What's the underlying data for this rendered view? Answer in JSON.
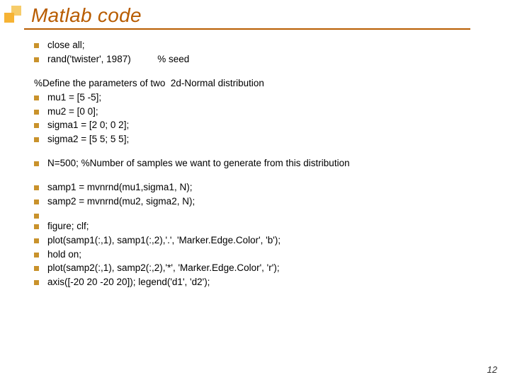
{
  "slide": {
    "title": "Matlab code",
    "page_number": "12",
    "lines": [
      {
        "bullet": true,
        "text": "close all;"
      },
      {
        "bullet": true,
        "text": "rand('twister', 1987)          % seed"
      },
      {
        "spacer": true
      },
      {
        "bullet": false,
        "text": "%Define the parameters of two  2d-Normal distribution"
      },
      {
        "bullet": true,
        "text": "mu1 = [5 -5];"
      },
      {
        "bullet": true,
        "text": "mu2 = [0 0];"
      },
      {
        "bullet": true,
        "text": "sigma1 = [2 0; 0 2];"
      },
      {
        "bullet": true,
        "text": "sigma2 = [5 5; 5 5];"
      },
      {
        "spacer": true
      },
      {
        "bullet": true,
        "text": "N=500; %Number of samples we want to generate from this distribution"
      },
      {
        "spacer": true
      },
      {
        "bullet": true,
        "text": "samp1 = mvnrnd(mu1,sigma1, N);"
      },
      {
        "bullet": true,
        "text": "samp2 = mvnrnd(mu2, sigma2, N);"
      },
      {
        "bullet": true,
        "text": ""
      },
      {
        "bullet": true,
        "text": "figure; clf;"
      },
      {
        "bullet": true,
        "text": "plot(samp1(:,1), samp1(:,2),'.', 'Marker.Edge.Color', 'b');"
      },
      {
        "bullet": true,
        "text": "hold on;"
      },
      {
        "bullet": true,
        "text": "plot(samp2(:,1), samp2(:,2),'*', 'Marker.Edge.Color', 'r');"
      },
      {
        "bullet": true,
        "text": "axis([-20 20 -20 20]); legend('d1', 'd2');"
      }
    ]
  }
}
